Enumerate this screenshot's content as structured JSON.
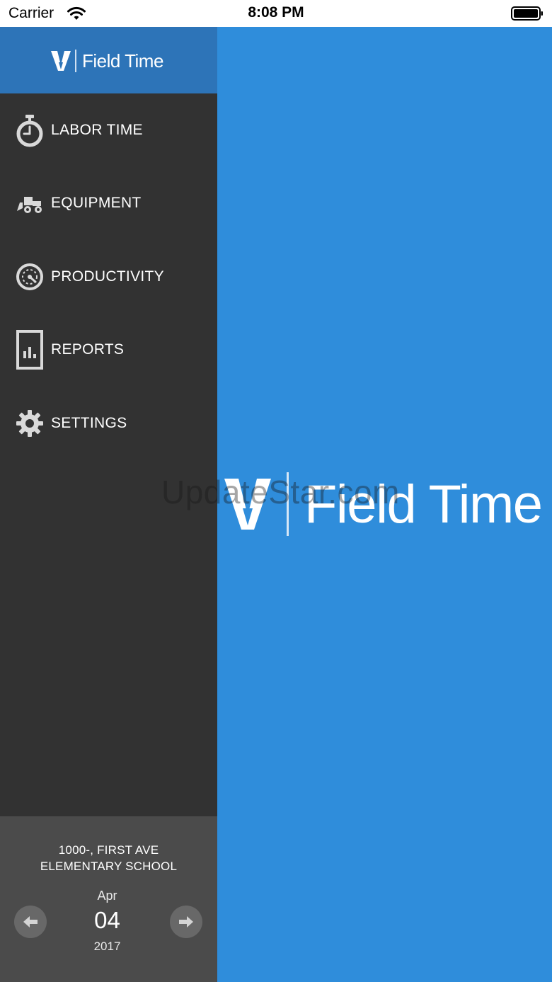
{
  "status_bar": {
    "carrier": "Carrier",
    "time": "8:08 PM"
  },
  "brand": {
    "name": "Field Time",
    "logo_icon": "v-logo-icon",
    "accent_color": "#2f8ddb",
    "header_color": "#2d74b8"
  },
  "nav": {
    "items": [
      {
        "label": "LABOR TIME",
        "icon": "stopwatch-icon"
      },
      {
        "label": "EQUIPMENT",
        "icon": "bulldozer-icon"
      },
      {
        "label": "PRODUCTIVITY",
        "icon": "gauge-icon"
      },
      {
        "label": "REPORTS",
        "icon": "bar-chart-icon"
      },
      {
        "label": "SETTINGS",
        "icon": "gear-icon"
      }
    ]
  },
  "job": {
    "line1": "1000-, FIRST AVE",
    "line2": "ELEMENTARY SCHOOL"
  },
  "date": {
    "month": "Apr",
    "day": "04",
    "year": "2017"
  },
  "watermark": "UpdateStar.com"
}
